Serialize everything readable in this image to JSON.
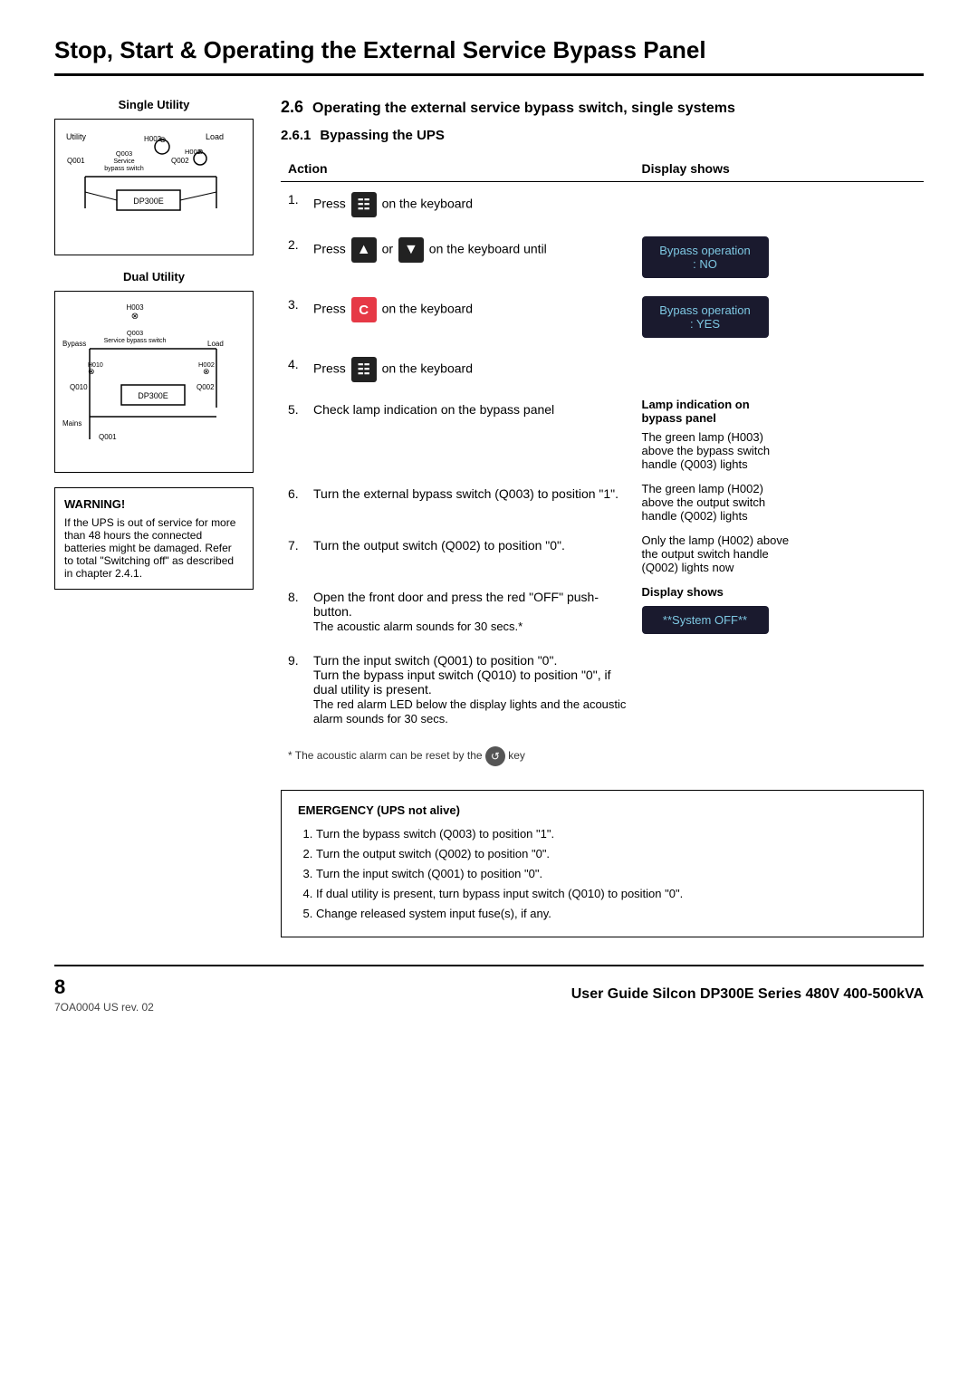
{
  "page": {
    "title": "Stop, Start & Operating the External Service Bypass Panel",
    "footer_ref": "7OA0004 US rev. 02",
    "page_number": "8",
    "footer_guide": "User Guide Silcon DP300E Series 480V 400-500kVA"
  },
  "left": {
    "single_utility_label": "Single Utility",
    "dual_utility_label": "Dual Utility",
    "warning_title": "WARNING!",
    "warning_text": "If the UPS is out of service for more than 48 hours the connected batteries might be damaged. Refer to total \"Switching off\" as described in chapter 2.4.1."
  },
  "section": {
    "number": "2.6",
    "title": "Operating the external service bypass switch, single systems",
    "subsection_number": "2.6.1",
    "subsection_title": "Bypassing the UPS",
    "action_header": "Action",
    "display_header": "Display shows",
    "steps": [
      {
        "num": "1.",
        "text": "Press",
        "icon": "menu-icon",
        "suffix": "on the keyboard"
      },
      {
        "num": "2.",
        "text": "Press",
        "icon": "arrow-up-icon",
        "middle": "or",
        "icon2": "arrow-down-icon",
        "suffix": "on the keyboard until"
      },
      {
        "num": "3.",
        "text": "Press",
        "icon": "c-key-icon",
        "suffix": "on the keyboard"
      },
      {
        "num": "4.",
        "text": "Press",
        "icon": "menu-icon",
        "suffix": "on the keyboard"
      },
      {
        "num": "5.",
        "text": "Check lamp indication on the bypass panel"
      },
      {
        "num": "6.",
        "text": "Turn the external bypass switch (Q003) to position \"1\"."
      },
      {
        "num": "7.",
        "text": "Turn the output switch (Q002) to position \"0\"."
      },
      {
        "num": "8.",
        "text": "Open the front door and press the red \"OFF\" push-button.\nThe acoustic alarm sounds for 30 secs.*"
      },
      {
        "num": "9.",
        "text": "Turn the input switch (Q001) to position \"0\". Turn the bypass input switch (Q010) to position \"0\", if dual utility is present.\nThe red alarm LED below the display lights and the acoustic alarm sounds for 30 secs."
      }
    ],
    "acoustic_note": "* The acoustic alarm can be reset by the",
    "display_no": "Bypass operation\n: NO",
    "display_yes": "Bypass operation\n: YES",
    "lamp_label": "Lamp indication on\nbypass panel",
    "lamp_step5": "The green lamp (H003)\nabove the bypass switch\nhandle (Q003) lights",
    "lamp_step6": "The green lamp (H002)\nabove the output switch\nhandle (Q002) lights",
    "lamp_step7": "Only the lamp (H002) above\nthe output switch handle\n(Q002) lights now",
    "display_shows2": "Display shows",
    "system_off": "**System OFF**"
  },
  "emergency": {
    "title": "EMERGENCY (UPS not alive)",
    "steps": [
      "Turn the bypass switch (Q003) to position \"1\".",
      "Turn the output switch (Q002) to position \"0\".",
      "Turn the input switch (Q001) to position \"0\".",
      "If dual utility is present, turn bypass input switch (Q010) to position \"0\".",
      "Change released system input fuse(s), if any."
    ]
  }
}
